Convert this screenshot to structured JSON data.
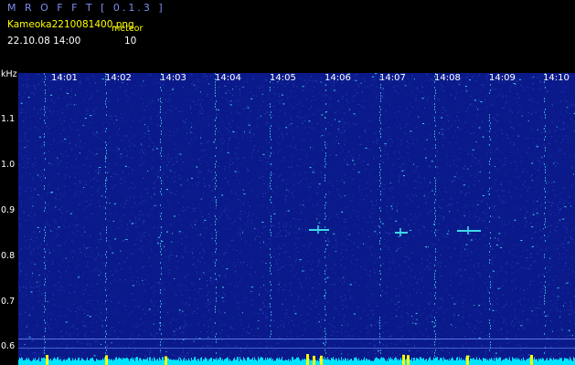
{
  "header": {
    "app_title": "M R O F F T  [ 0.1.3 ]",
    "file_name": "Kameoka2210081400.png",
    "detect_label": "meteor",
    "date_time": "22.10.08  14:00",
    "count": "10"
  },
  "axis": {
    "unit": "kHz",
    "time_ticks": [
      "14:01",
      "14:02",
      "14:03",
      "14:04",
      "14:05",
      "14:06",
      "14:07",
      "14:08",
      "14:09",
      "14:10"
    ],
    "freq_ticks": [
      "1.1",
      "1.0",
      "0.9",
      "0.8",
      "0.7",
      "0.6"
    ]
  },
  "colors": {
    "background": "#0b1a8a",
    "noise_dim": "#2a4ad0",
    "noise_bright": "#3fd8e8",
    "baseline": "#00e5ff",
    "meteor": "#ffff00",
    "title": "#7c8cf0"
  }
}
